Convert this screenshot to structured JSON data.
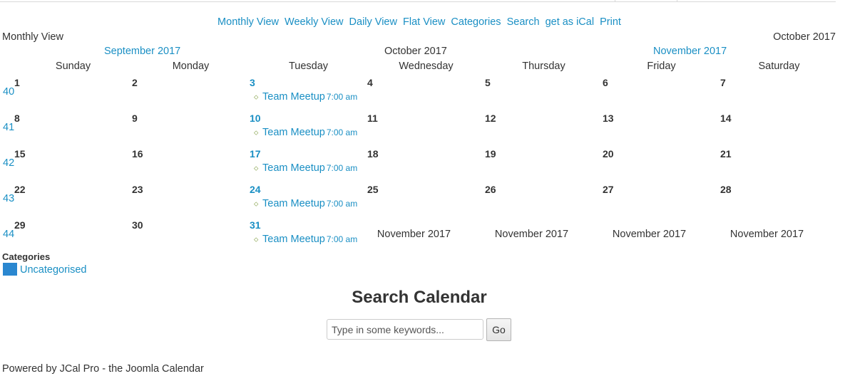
{
  "nav": {
    "items": [
      "Monthly View",
      "Weekly View",
      "Daily View",
      "Flat View",
      "Categories",
      "Search",
      "get as iCal",
      "Print"
    ]
  },
  "header": {
    "view_label": "Monthly View",
    "current_month": "October 2017",
    "prev_month": "September 2017",
    "center_month": "October 2017",
    "next_month": "November 2017"
  },
  "weekdays": [
    "Sunday",
    "Monday",
    "Tuesday",
    "Wednesday",
    "Thursday",
    "Friday",
    "Saturday"
  ],
  "weeks": [
    {
      "num": "40",
      "days": [
        "1",
        "2",
        "3",
        "4",
        "5",
        "6",
        "7"
      ]
    },
    {
      "num": "41",
      "days": [
        "8",
        "9",
        "10",
        "11",
        "12",
        "13",
        "14"
      ]
    },
    {
      "num": "42",
      "days": [
        "15",
        "16",
        "17",
        "18",
        "19",
        "20",
        "21"
      ]
    },
    {
      "num": "43",
      "days": [
        "22",
        "23",
        "24",
        "25",
        "26",
        "27",
        "28"
      ]
    },
    {
      "num": "44",
      "days": [
        "29",
        "30",
        "31",
        "November 2017",
        "November 2017",
        "November 2017",
        "November 2017"
      ]
    }
  ],
  "event": {
    "title": "Team Meetup",
    "time": "7:00 am"
  },
  "categories": {
    "title": "Categories",
    "items": [
      {
        "label": "Uncategorised",
        "color": "#2a87d0"
      }
    ]
  },
  "search": {
    "title": "Search Calendar",
    "placeholder": "Type in some keywords...",
    "button": "Go"
  },
  "footer": {
    "text": "Powered by JCal Pro - the Joomla Calendar"
  },
  "colors": {
    "link": "#1a8fc4",
    "event_icon": "#6b8e23"
  }
}
